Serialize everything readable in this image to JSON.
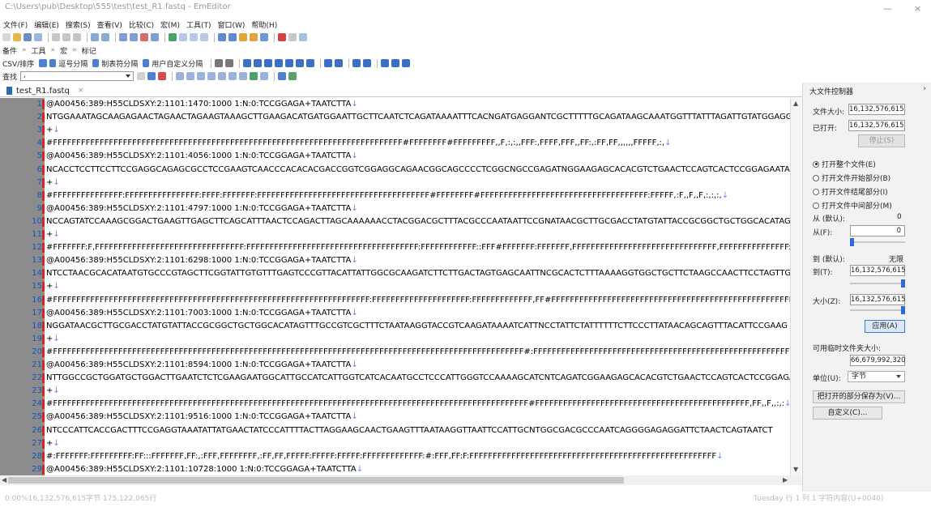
{
  "title_bar": {
    "path_text": "C:\\Users\\pub\\Desktop\\555\\test\\test_R1.fastq - EmEditor",
    "minimize": "—",
    "close": "×"
  },
  "menu": [
    "文件(F)",
    "编辑(E)",
    "搜索(S)",
    "查看(V)",
    "比较(C)",
    "宏(M)",
    "工具(T)",
    "窗口(W)",
    "帮助(H)"
  ],
  "toolbar_labels": {
    "bookmarks": "备件",
    "tools": "工具",
    "macros": "宏",
    "mark": "标记",
    "csv": "CSV/排序",
    "comma": "逗号分隔",
    "tab_sep": "制表符分隔",
    "user_sep": "用户自定义分隔",
    "find": "查找",
    "find_value": ","
  },
  "tab": {
    "name": "test_R1.fastq",
    "close": "×"
  },
  "lines": [
    {
      "n": "1",
      "text": "@A00456:389:H55CLDSXY:2:1101:1470:1000 1:N:0:TCCGGAGA+TAATCTTA",
      "eol": "↓"
    },
    {
      "n": "2",
      "text": "NTGGAAATAGCAAGAGAACTAGAACTAGAAGTAAAGCTTGAAGACATGATGGAATTGCTTCAATCTCAGATAAAATTTCACNGATGAGGANTCGCTTTTTGCAGATAAGCAAATGGTTTATTTAGATTGTATGGAGG",
      "eol": ""
    },
    {
      "n": "3",
      "text": "+",
      "eol": "↓"
    },
    {
      "n": "4",
      "text": "#FFFFFFFFFFFFFFFFFFFFFFFFFFFFFFFFFFFFFFFFFFFFFFFFFFFFFFFFFFFFFFFFFFFFFFFFFFF#FFFFFFFF#FFFFFFFFF,,F,:,:,,FFF:,FFFF,FFF,,FF:,:FF,FF,,,,,,FFFFF,:,",
      "eol": "↓"
    },
    {
      "n": "5",
      "text": "@A00456:389:H55CLDSXY:2:1101:4056:1000 1:N:0:TCCGGAGA+TAATCTTA",
      "eol": "↓"
    },
    {
      "n": "6",
      "text": "NCACCTCCTTCCTTCCGAGGCAGAGCGCCTCCGAAGTCAACCCACACACGACCGGTCGGAGGCAGAACGGCAGCCCCTCGGCNGCCGAGATNGGAAGAGCACACGTCTGAACTCCAGTCACTCCGGAGAATAATC",
      "eol": ""
    },
    {
      "n": "7",
      "text": "+",
      "eol": "↓"
    },
    {
      "n": "8",
      "text": "#FFFFFFFFFFFFFFF:FFFFFFFFFFFFFFFF:FFFF:FFFFFFF:FFFFFFFFFFFFFFFFFFFFFFFFFFFFFFFFFFFFF#FFFFFFFF#FFFFFFFFFFFFFFFFFFFFFFFFFFFFFFFFFFFF:FFFFF,:F,,F,,F,:,:,:,",
      "eol": "↓"
    },
    {
      "n": "9",
      "text": "@A00456:389:H55CLDSXY:2:1101:4797:1000 1:N:0:TCCGGAGA+TAATCTTA",
      "eol": "↓"
    },
    {
      "n": "10",
      "text": "NCCAGTATCCAAAGCGGACTGAAGTTGAGCTTCAGCATTTAACTCCAGACTTAGCAAAAAACCTACGGACGCTTTACGCCCAATAATTCCGNATAACGCTTGCGACCTATGTATTACCGCGGCTGCTGGCACATAG",
      "eol": ""
    },
    {
      "n": "11",
      "text": "+",
      "eol": "↓"
    },
    {
      "n": "12",
      "text": "#FFFFFFF:F,FFFFFFFFFFFFFFFFFFFFFFFFFFFFFFFF:FFFFFFFFFFFFFFFFFFFFFFFFFFFFFFFFFFFFF:FFFFFFFFFFFF::FFF#FFFFFFF:FFFFFFF,FFFFFFFFFFFFFFFFFFFFFFFFFFFFFFF,FFFFFFFFFFFFFFF:FF",
      "eol": "↓"
    },
    {
      "n": "13",
      "text": "@A00456:389:H55CLDSXY:2:1101:6298:1000 1:N:0:TCCGGAGA+TAATCTTA",
      "eol": "↓"
    },
    {
      "n": "14",
      "text": "NTCCTAACGCACATAATGTGCCCGTAGCTTCGGTATTGTGTTTGAGTCCCGTTACATTATTGGCGCAAGATCTTCTTGACTAGTGAGCAATTNCGCACTCTTTAAAAGGTGGCTGCTTCTAAGCCAACTTCCTAGTTG",
      "eol": ""
    },
    {
      "n": "15",
      "text": "+",
      "eol": "↓"
    },
    {
      "n": "16",
      "text": "#FFFFFFFFFFFFFFFFFFFFFFFFFFFFFFFFFFFFFFFFFFFFFFFFFFFFFFFFFFFFFFFFFFFF:FFFFFFFFFFFFFFFFFFFFF:FFFFFFFFFFFFF,FF#FFFFFFFFFFFFFFFFFFFFFFFFFFFFFFFFFFFFFFFFFFFFFFFFFFFFF",
      "eol": "↓"
    },
    {
      "n": "17",
      "text": "@A00456:389:H55CLDSXY:2:1101:7003:1000 1:N:0:TCCGGAGA+TAATCTTA",
      "eol": "↓"
    },
    {
      "n": "18",
      "text": "NGGATAACGCTTGCGACCTATGTATTACCGCGGCTGCTGGCACATAGTTTGCCGTCGCTTTCTAATAAGGTACCGTCAAGATAAAATCATTNCCTATTCTATTTTTTCTTCCCTTATAACAGCAGTTTACATTCCGAAG",
      "eol": ""
    },
    {
      "n": "19",
      "text": "+",
      "eol": "↓"
    },
    {
      "n": "20",
      "text": "#FFFFFFFFFFFFFFFFFFFFFFFFFFFFFFFFFFFFFFFFFFFFFFFFFFFFFFFFFFFFFFFFFFFFFFFFFFFFFFFFFFFFFFFFFFFFFFFFFFFFF#:FFFFFFFFFFFFFFFFFFFFFFFFFFFFFFFFFFFFFFFFFFFFFFFFFFFFFFFFFF",
      "eol": "↓"
    },
    {
      "n": "21",
      "text": "@A00456:389:H55CLDSXY:2:1101:8594:1000 1:N:0:TCCGGAGA+TAATCTTA",
      "eol": "↓"
    },
    {
      "n": "22",
      "text": "NTTGGCCGCTGGATGCTGGACTTGAATCTCTCGAAGAATGGCATTGCCATCATTGGTCATCACAATGCCTCCCATTGGGTCCAAAAGCATCNTCAGATCGGAAGAGCACACGTCTGAACTCCAGTCACTCCGGAGA",
      "eol": ""
    },
    {
      "n": "23",
      "text": "+",
      "eol": "↓"
    },
    {
      "n": "24",
      "text": "#FFFFFFFFFFFFFFFFFFFFFFFFFFFFFFFFFFFFFFFFFFFFFFFFFFFFFFFFFFFFFFFFFFFFFFFFFFFFFFFFFFFFFFFFFFFFFFFFFFFFFF#FFFFFFFFFFFFFFFFFFFFFFFFFFFFFFFFFFFFFFFFFFFFFF,FF,,F,,:,:",
      "eol": "↓"
    },
    {
      "n": "25",
      "text": "@A00456:389:H55CLDSXY:2:1101:9516:1000 1:N:0:TCCGGAGA+TAATCTTA",
      "eol": "↓"
    },
    {
      "n": "26",
      "text": "NTCCCATTCACCGACTTTCCGAGGTAAATATTATGAACTATCCCATTTTACTTAGGAAGCAACTGAAGTTTAATAAGGTTAATTCCATTGCNTGGCGACGCCCAATCAGGGGAGAGGATTCTAACTCAGTAATCT",
      "eol": ""
    },
    {
      "n": "27",
      "text": "+",
      "eol": "↓"
    },
    {
      "n": "28",
      "text": "#:FFFFFFF:FFFFFFFFF:FF:::FFFFFFF,FF:,:FFF,FFFFFFFF,:FF,FF,FFFFF:FFFFF:FFFFF:FFFFFFFFFFFFF:#:FFF,FF:F:FFFFFFFFFFFFFFFFFFFFFFFFFFFFFFFFFFFFFFFFFFFFFFFFFFFFF",
      "eol": "↓"
    },
    {
      "n": "29",
      "text": "@A00456:389:H55CLDSXY:2:1101:10728:1000 1:N:0:TCCGGAGA+TAATCTTA",
      "eol": "↓"
    }
  ],
  "status_bar": {
    "left": "0.00%16,132,576,615字节 175,122,065行",
    "right": "Tuesday 行 1 列 1 字符内容(U+0040)"
  },
  "panel": {
    "title": "大文件控制器",
    "close": "›",
    "file_size_label": "文件大小:",
    "file_size_value": "16,132,576,615",
    "opened_label": "已打开:",
    "opened_value": "16,132,576,615",
    "stop_button": "停止(S)",
    "radio_options": [
      "打开整个文件(E)",
      "打开文件开始部分(B)",
      "打开文件结尾部分(I)",
      "打开文件中间部分(M)"
    ],
    "radio_selected": 0,
    "from_default_label": "从 (默认):",
    "from_default_value": "0",
    "from_label": "从(F):",
    "from_value": "0",
    "to_default_label": "到 (默认):",
    "to_default_value": "无限",
    "to_label": "到(T):",
    "to_value": "16,132,576,615",
    "size_label": "大小(Z):",
    "size_value": "16,132,576,615",
    "apply_button": "应用(A)",
    "temp_folder_label": "可用临时文件夹大小:",
    "temp_folder_value": "66,679,992,320",
    "unit_label": "单位(U):",
    "unit_value": "字节",
    "save_part_button": "把打开的部分保存为(V)...",
    "custom_button": "自定义(C)..."
  },
  "colors": {
    "line_number": "#0a57c2",
    "gutter": "#8c8c8c",
    "change_marker": "#e02020",
    "eol_arrow": "#5b8ff0",
    "slider_thumb": "#2e6bd6"
  },
  "sliders": {
    "from_fraction": 0.0,
    "to_fraction": 1.0,
    "size_fraction": 1.0
  }
}
